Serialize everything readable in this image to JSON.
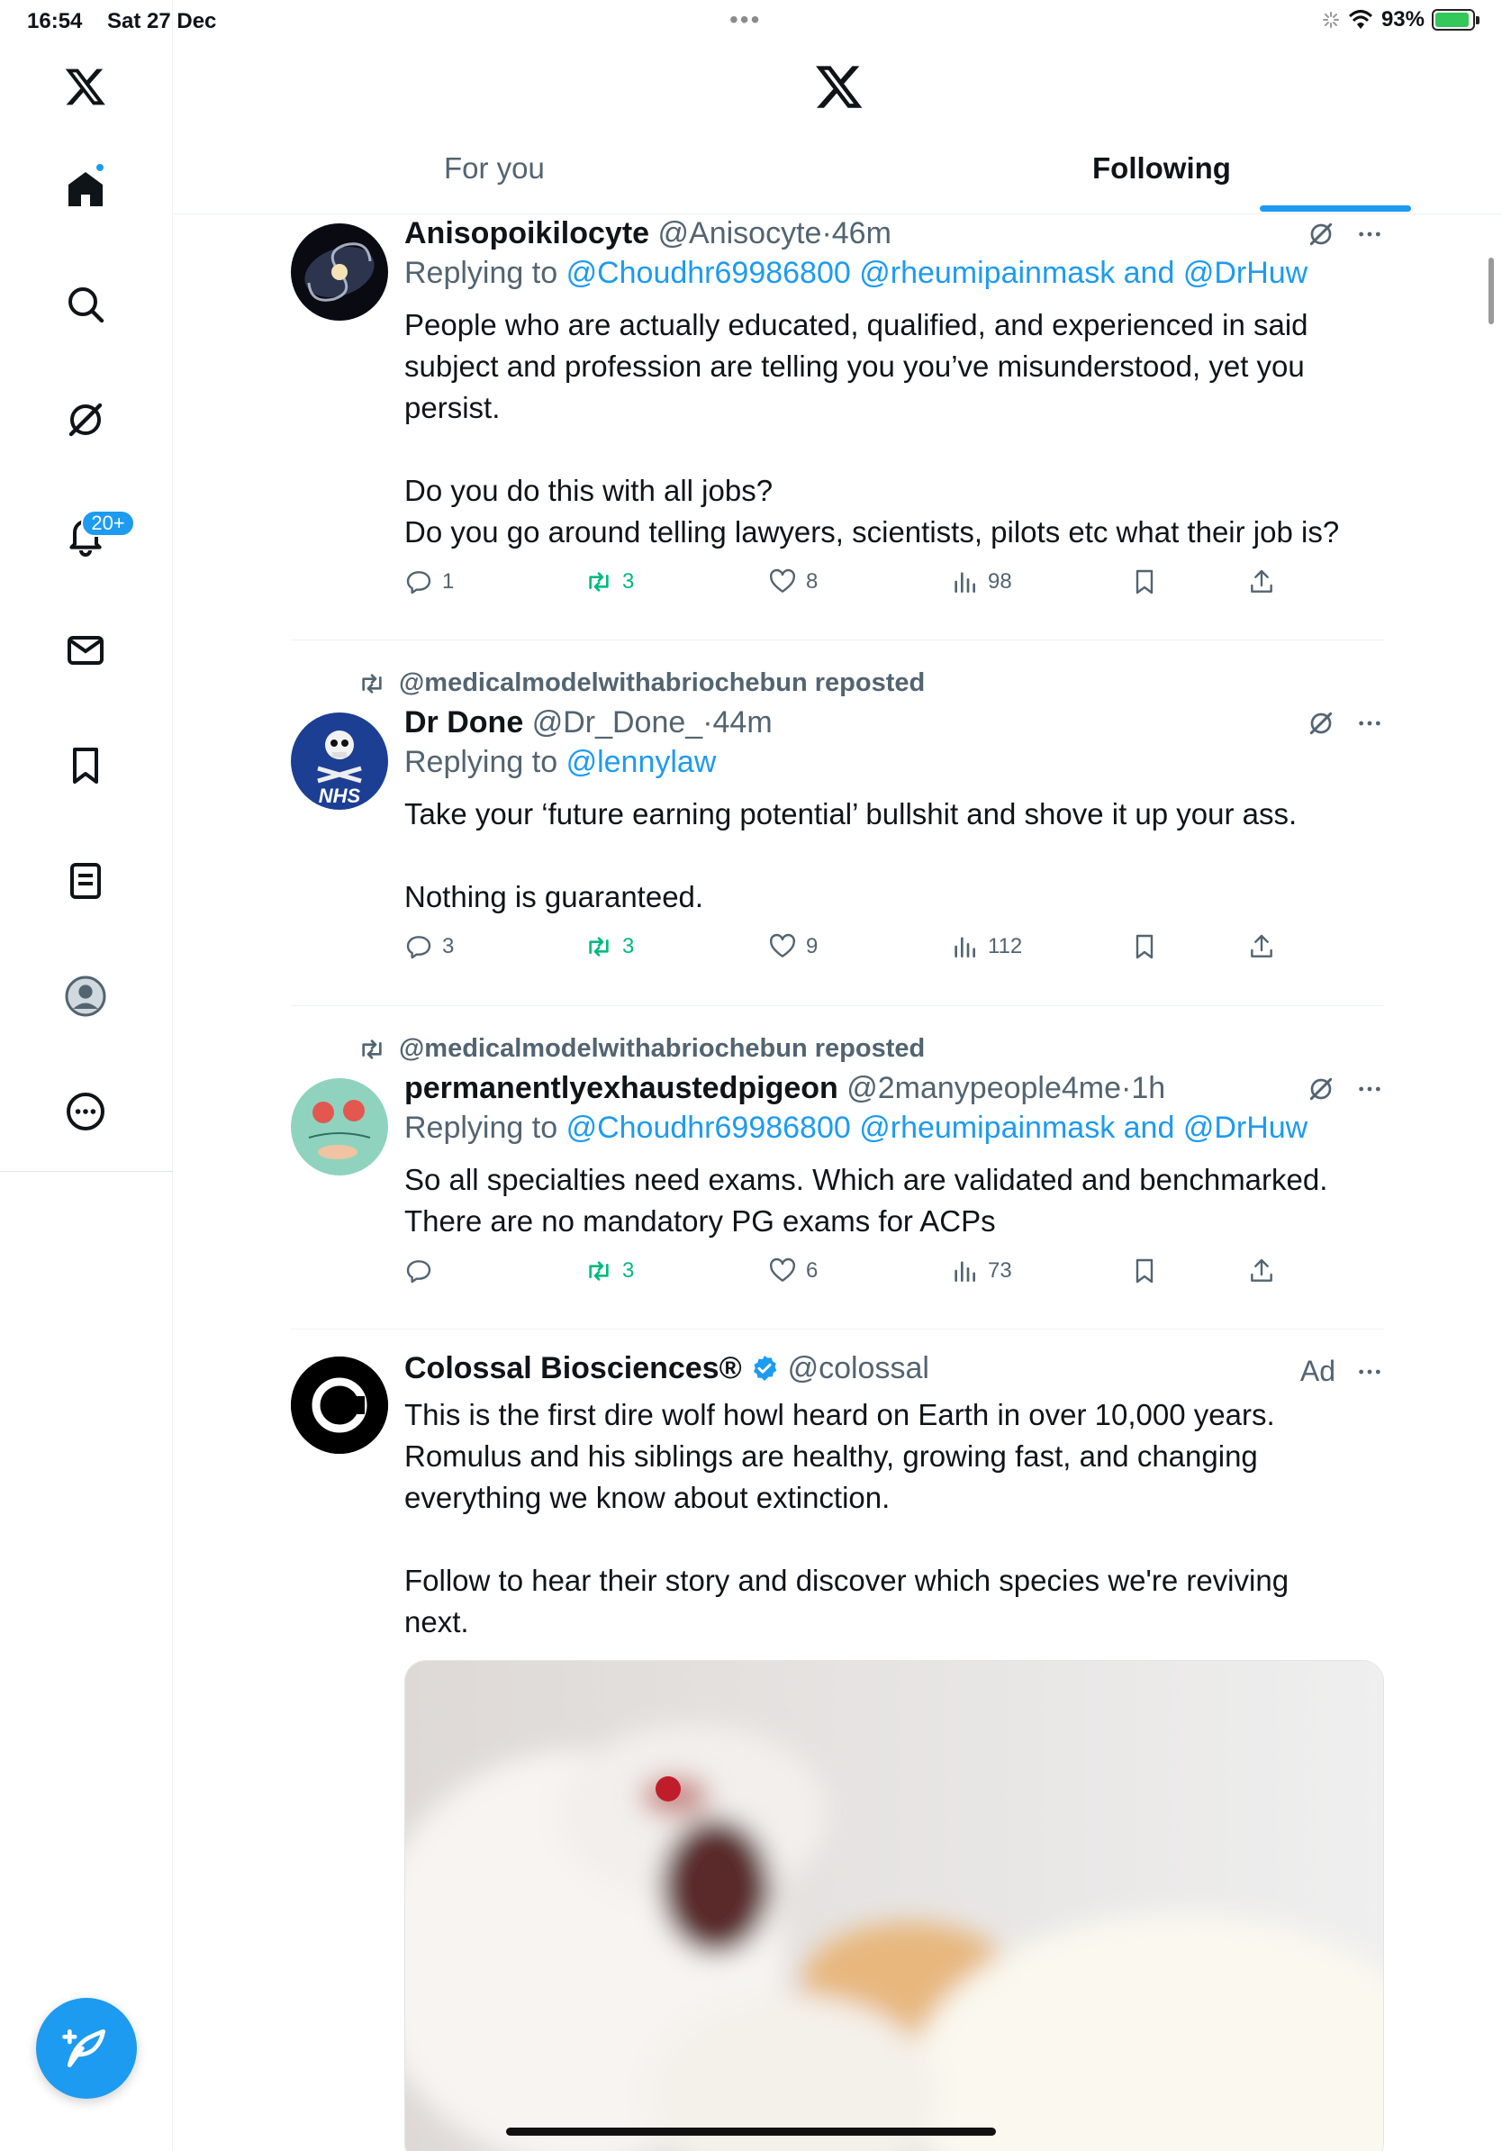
{
  "status_bar": {
    "time": "16:54",
    "date": "Sat 27 Dec",
    "battery": "93%",
    "battery_level": 0.93
  },
  "sidebar": {
    "items": [
      {
        "name": "x-logo-icon"
      },
      {
        "name": "home-icon"
      },
      {
        "name": "search-icon"
      },
      {
        "name": "grok-icon"
      },
      {
        "name": "notifications-icon"
      },
      {
        "name": "messages-icon"
      },
      {
        "name": "bookmarks-icon"
      },
      {
        "name": "lists-icon"
      },
      {
        "name": "profile-icon"
      },
      {
        "name": "more-icon"
      }
    ],
    "notification_badge": "20+",
    "compose_icon": "compose-icon"
  },
  "header": {
    "tabs": [
      {
        "label": "For you",
        "active": false
      },
      {
        "label": "Following",
        "active": true
      }
    ]
  },
  "posts": [
    {
      "name": "Anisopoikilocyte",
      "handle": "@Anisocyte",
      "time": "46m",
      "replying_prefix": "Replying to",
      "mentions": [
        "@Choudhr69986800",
        "@rheumipainmask",
        "and",
        "@DrHuw"
      ],
      "body": [
        "People who are actually educated, qualified, and experienced in said",
        "subject and profession are telling you you’ve misunderstood, yet you",
        "persist.",
        "",
        "Do you do this with all jobs?",
        "Do you go around telling lawyers, scientists, pilots etc what their job is?"
      ],
      "replies": "1",
      "reposts": "3",
      "likes": "8",
      "views": "98"
    },
    {
      "reposted_by": "@medicalmodelwithabriochebun reposted",
      "name": "Dr Done",
      "handle": "@Dr_Done_",
      "time": "44m",
      "replying_prefix": "Replying to",
      "mentions": [
        "@lennylaw"
      ],
      "body": [
        "Take your ‘future earning potential’ bullshit and shove it up your ass.",
        "",
        "Nothing is guaranteed."
      ],
      "replies": "3",
      "reposts": "3",
      "likes": "9",
      "views": "112"
    },
    {
      "reposted_by": "@medicalmodelwithabriochebun reposted",
      "name": "permanentlyexhaustedpigeon",
      "handle": "@2manypeople4me",
      "time": "1h",
      "replying_prefix": "Replying to",
      "mentions": [
        "@Choudhr69986800",
        "@rheumipainmask",
        "and",
        "@DrHuw"
      ],
      "body": [
        "So all specialties need exams. Which are validated and benchmarked.",
        "There are no mandatory PG exams for ACPs"
      ],
      "replies": "",
      "reposts": "3",
      "likes": "6",
      "views": "73"
    },
    {
      "name": "Colossal Biosciences®",
      "handle": "@colossal",
      "ad_label": "Ad",
      "body": [
        "This is the first dire wolf howl heard on Earth in over 10,000 years.",
        "Romulus and his siblings are healthy, growing fast, and changing",
        "everything we know about extinction.",
        "",
        "Follow to hear their story and discover which species we're reviving",
        "next."
      ]
    }
  ],
  "colors": {
    "accent": "#1d9bf0",
    "repost": "#00ba7c",
    "secondary_text": "#536471"
  }
}
